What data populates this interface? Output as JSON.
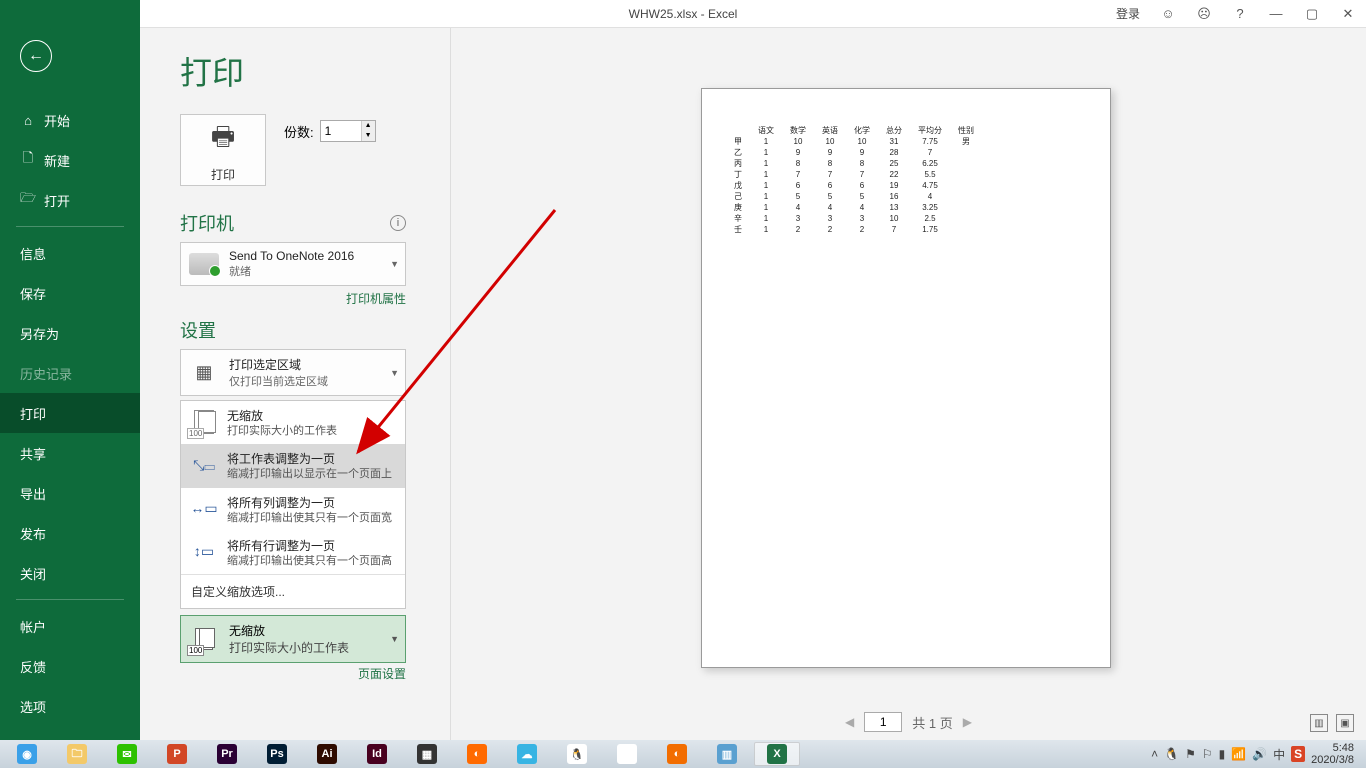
{
  "titlebar": {
    "title": "WHW25.xlsx  -  Excel",
    "login": "登录"
  },
  "sidebar": {
    "home": "开始",
    "new": "新建",
    "open": "打开",
    "info": "信息",
    "save": "保存",
    "saveas": "另存为",
    "history": "历史记录",
    "print": "打印",
    "share": "共享",
    "export": "导出",
    "publish": "发布",
    "close": "关闭",
    "account": "帐户",
    "feedback": "反馈",
    "options": "选项"
  },
  "panel": {
    "title": "打印",
    "print_button": "打印",
    "copies_label": "份数:",
    "copies_value": "1",
    "printer_heading": "打印机",
    "printer_name": "Send To OneNote 2016",
    "printer_status": "就绪",
    "printer_props": "打印机属性",
    "settings_heading": "设置",
    "area_title": "打印选定区域",
    "area_sub": "仅打印当前选定区域",
    "scale_opts": {
      "none_t": "无缩放",
      "none_s": "打印实际大小的工作表",
      "fit_t": "将工作表调整为一页",
      "fit_s": "缩减打印输出以显示在一个页面上",
      "cols_t": "将所有列调整为一页",
      "cols_s": "缩减打印输出使其只有一个页面宽",
      "rows_t": "将所有行调整为一页",
      "rows_s": "缩减打印输出使其只有一个页面高",
      "custom": "自定义缩放选项..."
    },
    "current_scale_t": "无缩放",
    "current_scale_s": "打印实际大小的工作表",
    "page_setup": "页面设置"
  },
  "pager": {
    "current": "1",
    "total_label": "共 1 页"
  },
  "taskbar": {
    "time": "5:48",
    "date": "2020/3/8"
  },
  "chart_data": {
    "type": "table",
    "title": "",
    "columns": [
      "",
      "语文",
      "数学",
      "英语",
      "化学",
      "总分",
      "平均分",
      "性别"
    ],
    "rows": [
      [
        "甲",
        1,
        10,
        10,
        10,
        31,
        7.75,
        "男"
      ],
      [
        "乙",
        1,
        9,
        9,
        9,
        28,
        7,
        ""
      ],
      [
        "丙",
        1,
        8,
        8,
        8,
        25,
        6.25,
        ""
      ],
      [
        "丁",
        1,
        7,
        7,
        7,
        22,
        5.5,
        ""
      ],
      [
        "戊",
        1,
        6,
        6,
        6,
        19,
        4.75,
        ""
      ],
      [
        "己",
        1,
        5,
        5,
        5,
        16,
        4,
        ""
      ],
      [
        "庚",
        1,
        4,
        4,
        4,
        13,
        3.25,
        ""
      ],
      [
        "辛",
        1,
        3,
        3,
        3,
        10,
        2.5,
        ""
      ],
      [
        "壬",
        1,
        2,
        2,
        2,
        7,
        1.75,
        ""
      ]
    ]
  }
}
